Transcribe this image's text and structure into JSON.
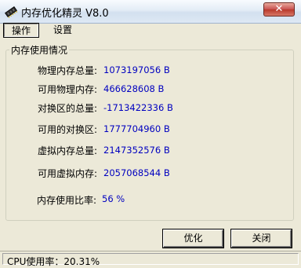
{
  "window": {
    "title": "内存优化精灵 V8.0",
    "close_label": "✕"
  },
  "menu": {
    "items": [
      {
        "label": "操作"
      },
      {
        "label": "设置"
      }
    ]
  },
  "memory_info": {
    "group_title": "内存使用情况",
    "rows": [
      {
        "label": "物理内存总量:",
        "value": "1073197056 B"
      },
      {
        "label": "可用物理内存:",
        "value": "466628608 B"
      },
      {
        "label": "对换区的总量:",
        "value": "-1713422336 B"
      },
      {
        "label": "可用的对换区:",
        "value": "1777704960 B"
      },
      {
        "label": "虚拟内存总量:",
        "value": "2147352576 B"
      },
      {
        "label": "可用虚拟内存:",
        "value": "2057068544 B"
      }
    ],
    "usage_ratio_label": "内存使用比率:",
    "usage_ratio_value": "56 %"
  },
  "buttons": {
    "optimize_label": "优化",
    "close_label": "关闭"
  },
  "status": {
    "cpu_text": "CPU使用率：20.31%"
  },
  "icons": {
    "app": "memory-chip-icon"
  }
}
